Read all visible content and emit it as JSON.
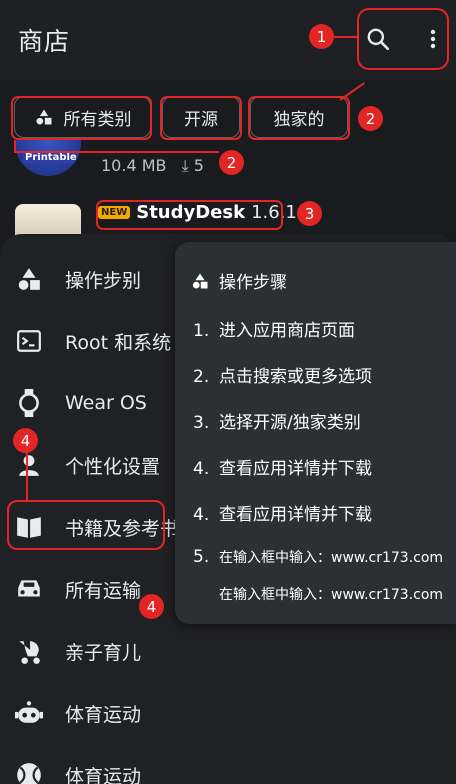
{
  "appbar": {
    "title": "商店",
    "search_icon": "search-icon",
    "more_icon": "more-vert-icon"
  },
  "chips": {
    "all": "所有类别",
    "open": "开源",
    "exclusive": "独家的"
  },
  "app1": {
    "thumb_text": "Printable",
    "size": "10.4 MB",
    "downloads": "5"
  },
  "app2": {
    "badge": "NEW",
    "name": "StudyDesk",
    "version": "1.6.1"
  },
  "drawer": {
    "items": [
      {
        "label": "操作步别",
        "icon": "category-shapes-icon"
      },
      {
        "label": "Root 和系统",
        "icon": "terminal-icon"
      },
      {
        "label": "Wear OS",
        "icon": "watch-icon"
      },
      {
        "label": "个性化设置",
        "icon": "person-icon"
      },
      {
        "label": "书籍及参考书",
        "icon": "book-icon"
      },
      {
        "label": "所有运输",
        "icon": "car-icon"
      },
      {
        "label": "亲子育儿",
        "icon": "stroller-icon"
      },
      {
        "label": "体育运动",
        "icon": "robot-icon"
      },
      {
        "label": "体育运动",
        "icon": "sports-ball-icon"
      }
    ]
  },
  "steps": {
    "title": "操作步骤",
    "items": [
      {
        "num": "1.",
        "text": "进入应用商店页面"
      },
      {
        "num": "2.",
        "text": "点击搜索或更多选项"
      },
      {
        "num": "3.",
        "text": "选择开源/独家类别"
      },
      {
        "num": "4.",
        "text": "查看应用详情并下载"
      },
      {
        "num": "4.",
        "text": "查看应用详情并下载"
      },
      {
        "num": "5.",
        "text": "在输入框中输入：www.cr173.com"
      }
    ],
    "extra": "在输入框中输入：www.cr173.com"
  },
  "markers": [
    "1",
    "2",
    "2",
    "3",
    "4",
    "4"
  ],
  "colors": {
    "highlight": "#e22525",
    "badge": "#f2a900",
    "background": "#1a1b1e"
  }
}
